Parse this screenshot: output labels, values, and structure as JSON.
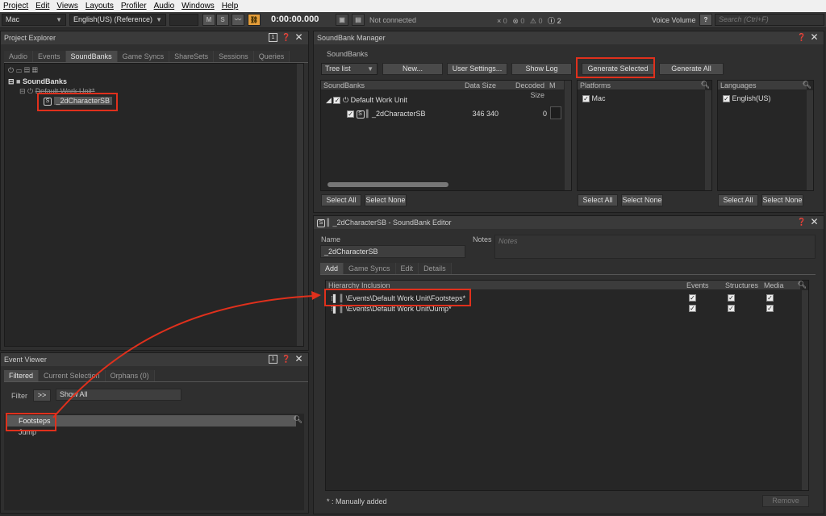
{
  "menu": [
    "Project",
    "Edit",
    "Views",
    "Layouts",
    "Profiler",
    "Audio",
    "Windows",
    "Help"
  ],
  "toolbar": {
    "platform": "Mac",
    "language": "English(US) (Reference)",
    "m_label": "M",
    "s_label": "S",
    "time": "0:00:00.000",
    "connection": "Not connected",
    "err_count": "0",
    "warn_count": "0",
    "info_count": "2",
    "voice_label": "Voice Volume",
    "help_label": "?",
    "search_placeholder": "Search (Ctrl+F)"
  },
  "project_explorer": {
    "title": "Project Explorer",
    "tabs": [
      "Audio",
      "Events",
      "SoundBanks",
      "Game Syncs",
      "ShareSets",
      "Sessions",
      "Queries"
    ],
    "active_tab": "SoundBanks",
    "root": "SoundBanks",
    "work_unit": "Default Work Unit*",
    "soundbank": "_2dCharacterSB"
  },
  "event_viewer": {
    "title": "Event Viewer",
    "tabs": [
      "Filtered",
      "Current Selection",
      "Orphans (0)"
    ],
    "filter_label": "Filter",
    "filter_btn": ">>",
    "filter_value": "Show All",
    "events": [
      "Footsteps",
      "Jump"
    ]
  },
  "sbm": {
    "title": "SoundBank Manager",
    "section": "SoundBanks",
    "view_mode": "Tree list",
    "buttons": {
      "new": "New...",
      "user_settings": "User Settings...",
      "show_log": "Show Log",
      "generate_selected": "Generate Selected",
      "generate_all": "Generate All"
    },
    "cols": {
      "soundbanks": "SoundBanks",
      "data_size": "Data Size",
      "decoded_size": "Decoded Size",
      "extra": "M"
    },
    "rows": [
      {
        "name": "Default Work Unit",
        "data_size": "",
        "decoded_size": ""
      },
      {
        "name": "_2dCharacterSB",
        "data_size": "346 340",
        "decoded_size": "0"
      }
    ],
    "platforms_header": "Platforms",
    "platform": "Mac",
    "languages_header": "Languages",
    "language": "English(US)",
    "select_all": "Select All",
    "select_none": "Select None"
  },
  "editor": {
    "title": "_2dCharacterSB - SoundBank Editor",
    "name_label": "Name",
    "name_value": "_2dCharacterSB",
    "notes_label": "Notes",
    "notes_placeholder": "Notes",
    "tabs": [
      "Add",
      "Game Syncs",
      "Edit",
      "Details"
    ],
    "active_tab": "Add",
    "cols": {
      "hierarchy": "Hierarchy Inclusion",
      "events": "Events",
      "structures": "Structures",
      "media": "Media"
    },
    "rows": [
      {
        "path": "\\Events\\Default Work Unit\\Footsteps*"
      },
      {
        "path": "\\Events\\Default Work Unit\\Jump*"
      }
    ],
    "footer_note": "* : Manually added",
    "remove": "Remove"
  },
  "accent": "#e0301c"
}
